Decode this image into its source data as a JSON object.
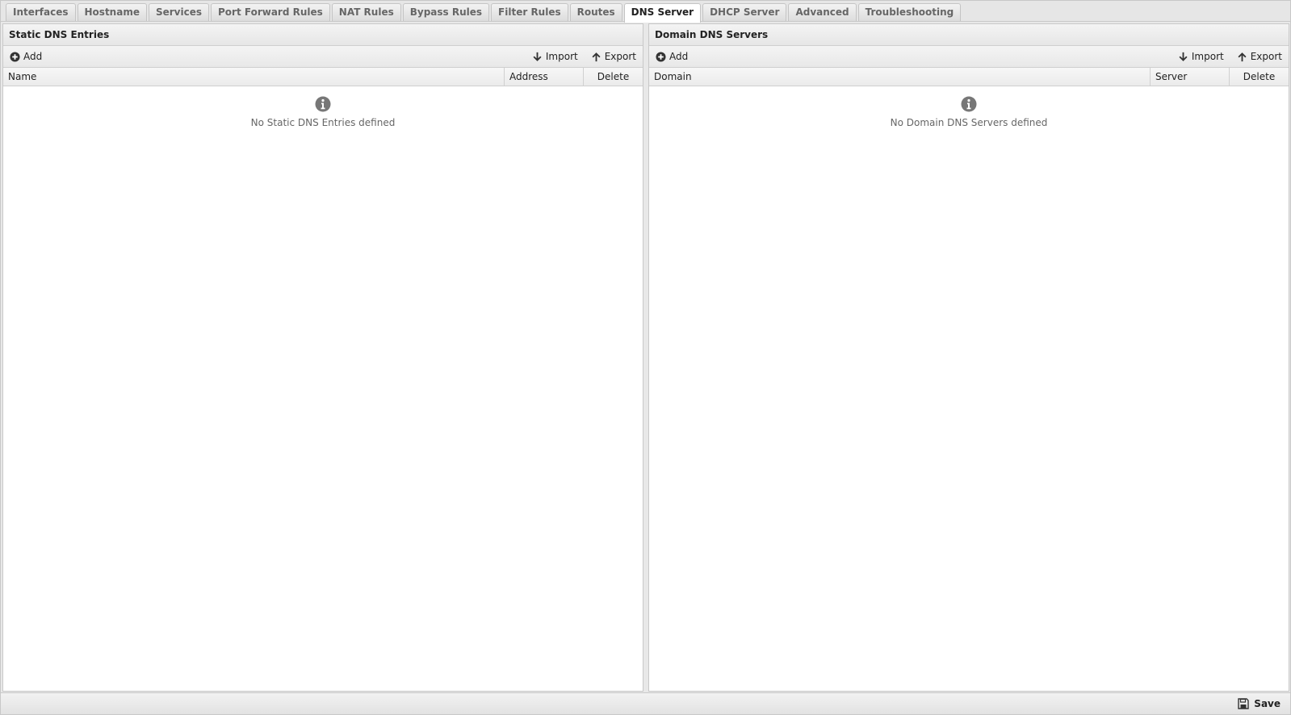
{
  "tabs": [
    {
      "label": "Interfaces"
    },
    {
      "label": "Hostname"
    },
    {
      "label": "Services"
    },
    {
      "label": "Port Forward Rules"
    },
    {
      "label": "NAT Rules"
    },
    {
      "label": "Bypass Rules"
    },
    {
      "label": "Filter Rules"
    },
    {
      "label": "Routes"
    },
    {
      "label": "DNS Server",
      "active": true
    },
    {
      "label": "DHCP Server"
    },
    {
      "label": "Advanced"
    },
    {
      "label": "Troubleshooting"
    }
  ],
  "left": {
    "title": "Static DNS Entries",
    "add": "Add",
    "import": "Import",
    "export": "Export",
    "columns": [
      "Name",
      "Address",
      "Delete"
    ],
    "empty": "No Static DNS Entries defined"
  },
  "right": {
    "title": "Domain DNS Servers",
    "add": "Add",
    "import": "Import",
    "export": "Export",
    "columns": [
      "Domain",
      "Server",
      "Delete"
    ],
    "empty": "No Domain DNS Servers defined"
  },
  "footer": {
    "save": "Save"
  },
  "icons": {
    "add": "plus-circle-icon",
    "import": "arrow-down-icon",
    "export": "arrow-up-icon",
    "info": "info-circle-icon",
    "save": "floppy-disk-icon"
  },
  "colors": {
    "icon": "#333333",
    "info": "#777777"
  }
}
